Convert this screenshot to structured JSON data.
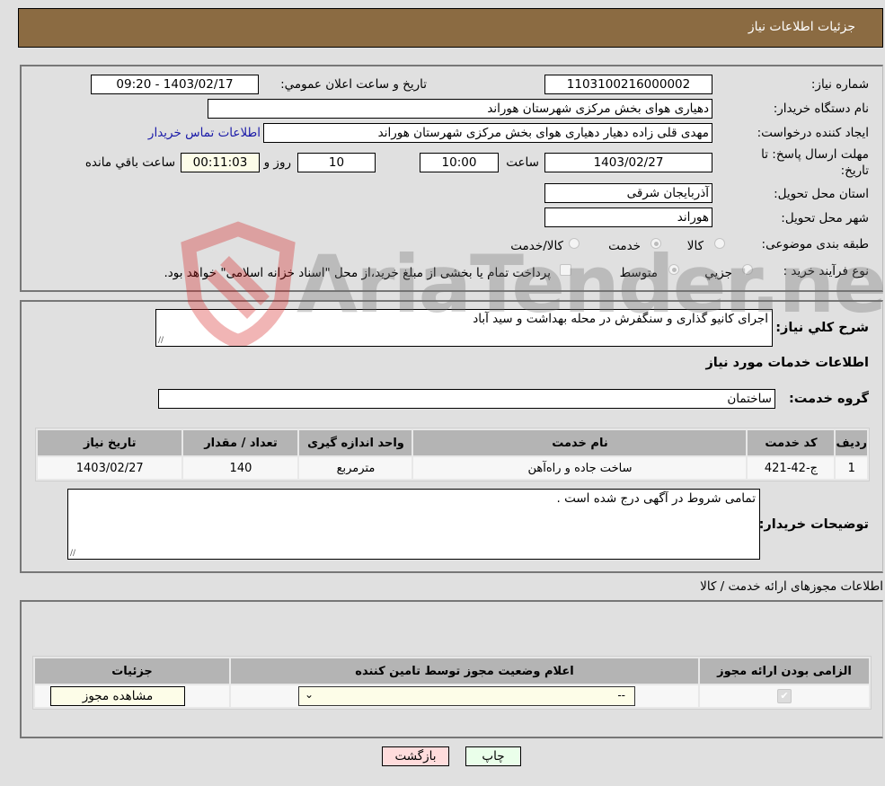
{
  "header": {
    "title": "جزئیات اطلاعات نیاز"
  },
  "details": {
    "need_number_label": "شماره نیاز:",
    "need_number": "1103100216000002",
    "announce_label": "تاریخ و ساعت اعلان عمومي:",
    "announce_value": "1403/02/17 - 09:20",
    "buyer_org_label": "نام دستگاه خریدار:",
    "buyer_org": "دهیاری هوای بخش مرکزی شهرستان هوراند",
    "creator_label": "ایجاد کننده درخواست:",
    "creator": "مهدی قلی زاده دهیار  دهیاری هوای بخش مرکزی شهرستان هوراند",
    "contact_link": "اطلاعات تماس خریدار",
    "deadline_label_1": "مهلت ارسال پاسخ: تا",
    "deadline_label_2": "تاریخ:",
    "deadline_date": "1403/02/27",
    "time_label": "ساعت",
    "deadline_time": "10:00",
    "days_value": "10",
    "days_label": "روز و",
    "remaining_time": "00:11:03",
    "remaining_label": "ساعت باقي مانده",
    "province_label": "استان محل تحویل:",
    "province": "آذربایجان شرقی",
    "city_label": "شهر محل تحویل:",
    "city": "هوراند",
    "category_label": "طبقه بندی موضوعی:",
    "category_options": [
      "کالا",
      "خدمت",
      "کالا/خدمت"
    ],
    "category_selected": "خدمت",
    "process_label": "نوع فرآیند خرید :",
    "process_options": [
      "جزیي",
      "متوسط"
    ],
    "process_selected": "متوسط",
    "treasury_note": "پرداخت تمام یا بخشی از مبلغ خرید،از محل \"اسناد خزانه اسلامی\" خواهد بود."
  },
  "description": {
    "label": "شرح کلي نیاز:",
    "value": "اجرای کانیو گذاری و سنگفرش در محله بهداشت و سید آباد",
    "services_heading": "اطلاعات خدمات مورد نیاز",
    "service_group_label": "گروه خدمت:",
    "service_group": "ساختمان"
  },
  "services_table": {
    "headers": [
      "ردیف",
      "کد خدمت",
      "نام خدمت",
      "واحد اندازه گیری",
      "تعداد / مقدار",
      "تاریخ نیاز"
    ],
    "rows": [
      [
        "1",
        "ج-42-421",
        "ساخت جاده و راه‌آهن",
        "مترمربع",
        "140",
        "1403/02/27"
      ]
    ]
  },
  "buyer_notes": {
    "label": "توضیحات خریدار:",
    "value": "تمامی شروط در آگهی درج شده است ."
  },
  "permits": {
    "heading": "اطلاعات مجوزهای ارائه خدمت / کالا",
    "headers": [
      "الزامی بودن ارائه مجوز",
      "اعلام وضعیت مجوز توسط تامین کننده",
      "جزئیات"
    ],
    "row": {
      "required_checked": true,
      "status_value": "--",
      "details_button": "مشاهده مجوز"
    }
  },
  "footer": {
    "print_button": "چاپ",
    "back_button": "بازگشت"
  },
  "watermark": {
    "text": "AriaTender.neT"
  },
  "colors": {
    "header_bg": "#8b6b42",
    "print_bg": "#eaffea",
    "back_bg": "#ffdcdc",
    "field_yellow": "#fdfde8"
  }
}
